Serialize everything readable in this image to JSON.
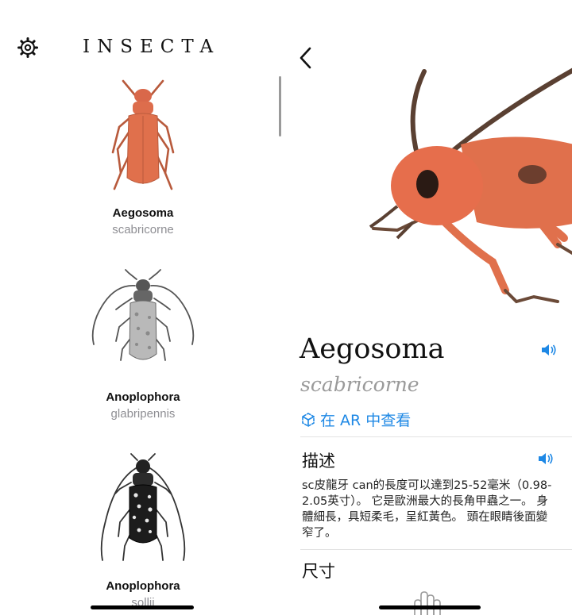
{
  "list": {
    "app_title": "INSECTA",
    "items": [
      {
        "genus": "Aegosoma",
        "species": "scabricorne"
      },
      {
        "genus": "Anoplophora",
        "species": "glabripennis"
      },
      {
        "genus": "Anoplophora",
        "species": "sollii"
      }
    ]
  },
  "detail": {
    "title": "Aegosoma",
    "subtitle": "scabricorne",
    "ar_label": "在 AR 中查看",
    "description_heading": "描述",
    "description": "sc皮龍牙 can的長度可以達到25-52毫米（0.98-2.05英寸）。 它是歐洲最大的長角甲蟲之一。 身體細長，具短柔毛，呈紅黃色。 頭在眼睛後面變窄了。",
    "size_heading": "尺寸"
  },
  "icons": {
    "settings": "gear-icon",
    "back": "chevron-left-icon",
    "speaker": "speaker-icon",
    "ar": "ar-cube-icon"
  },
  "colors": {
    "accent": "#1e88e5",
    "beetle_orange": "#e0704c",
    "secondary_text": "#8e8e93"
  }
}
